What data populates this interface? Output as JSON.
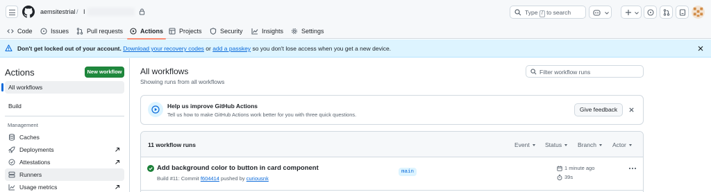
{
  "header": {
    "owner": "aemsitestrial",
    "separator": "/",
    "repo": "I",
    "search_prefix": "Type",
    "search_key": "/",
    "search_suffix": "to search"
  },
  "repo_nav": {
    "tabs": [
      {
        "label": "Code",
        "icon": "code-icon"
      },
      {
        "label": "Issues",
        "icon": "issue-icon"
      },
      {
        "label": "Pull requests",
        "icon": "pull-request-icon"
      },
      {
        "label": "Actions",
        "icon": "play-icon"
      },
      {
        "label": "Projects",
        "icon": "table-icon"
      },
      {
        "label": "Security",
        "icon": "shield-icon"
      },
      {
        "label": "Insights",
        "icon": "graph-icon"
      },
      {
        "label": "Settings",
        "icon": "gear-icon"
      }
    ],
    "active": "Actions"
  },
  "banner": {
    "bold": "Don't get locked out of your account.",
    "link1": "Download your recovery codes",
    "mid": "or",
    "link2": "add a passkey",
    "rest": "so you don't lose access when you get a new device."
  },
  "sidebar": {
    "title": "Actions",
    "new_workflow": "New workflow",
    "all_workflows": "All workflows",
    "build": "Build",
    "management_heading": "Management",
    "items": [
      {
        "label": "Caches",
        "icon": "database-icon",
        "external": false
      },
      {
        "label": "Deployments",
        "icon": "rocket-icon",
        "external": true
      },
      {
        "label": "Attestations",
        "icon": "verified-icon",
        "external": true
      },
      {
        "label": "Runners",
        "icon": "server-icon",
        "external": false
      },
      {
        "label": "Usage metrics",
        "icon": "graph-icon",
        "external": true
      }
    ]
  },
  "main": {
    "title": "All workflows",
    "subtitle": "Showing runs from all workflows",
    "filter_placeholder": "Filter workflow runs",
    "feedback": {
      "title": "Help us improve GitHub Actions",
      "subtitle": "Tell us how to make GitHub Actions work better for you with three quick questions.",
      "button": "Give feedback"
    },
    "runs": {
      "count_label": "11 workflow runs",
      "filters": [
        "Event",
        "Status",
        "Branch",
        "Actor"
      ],
      "items": [
        {
          "title": "Add background color to button in card component",
          "meta_prefix": "Build #11: Commit",
          "commit": "f604414",
          "meta_mid": "pushed by",
          "actor": "curiousnk",
          "branch": "main",
          "time": "1 minute ago",
          "duration": "39s",
          "status": "success"
        }
      ]
    }
  },
  "colors": {
    "accent": "#0969da",
    "success": "#1a7f37",
    "active_tab_underline": "#fd8c73",
    "banner_bg": "#ddf4ff"
  }
}
